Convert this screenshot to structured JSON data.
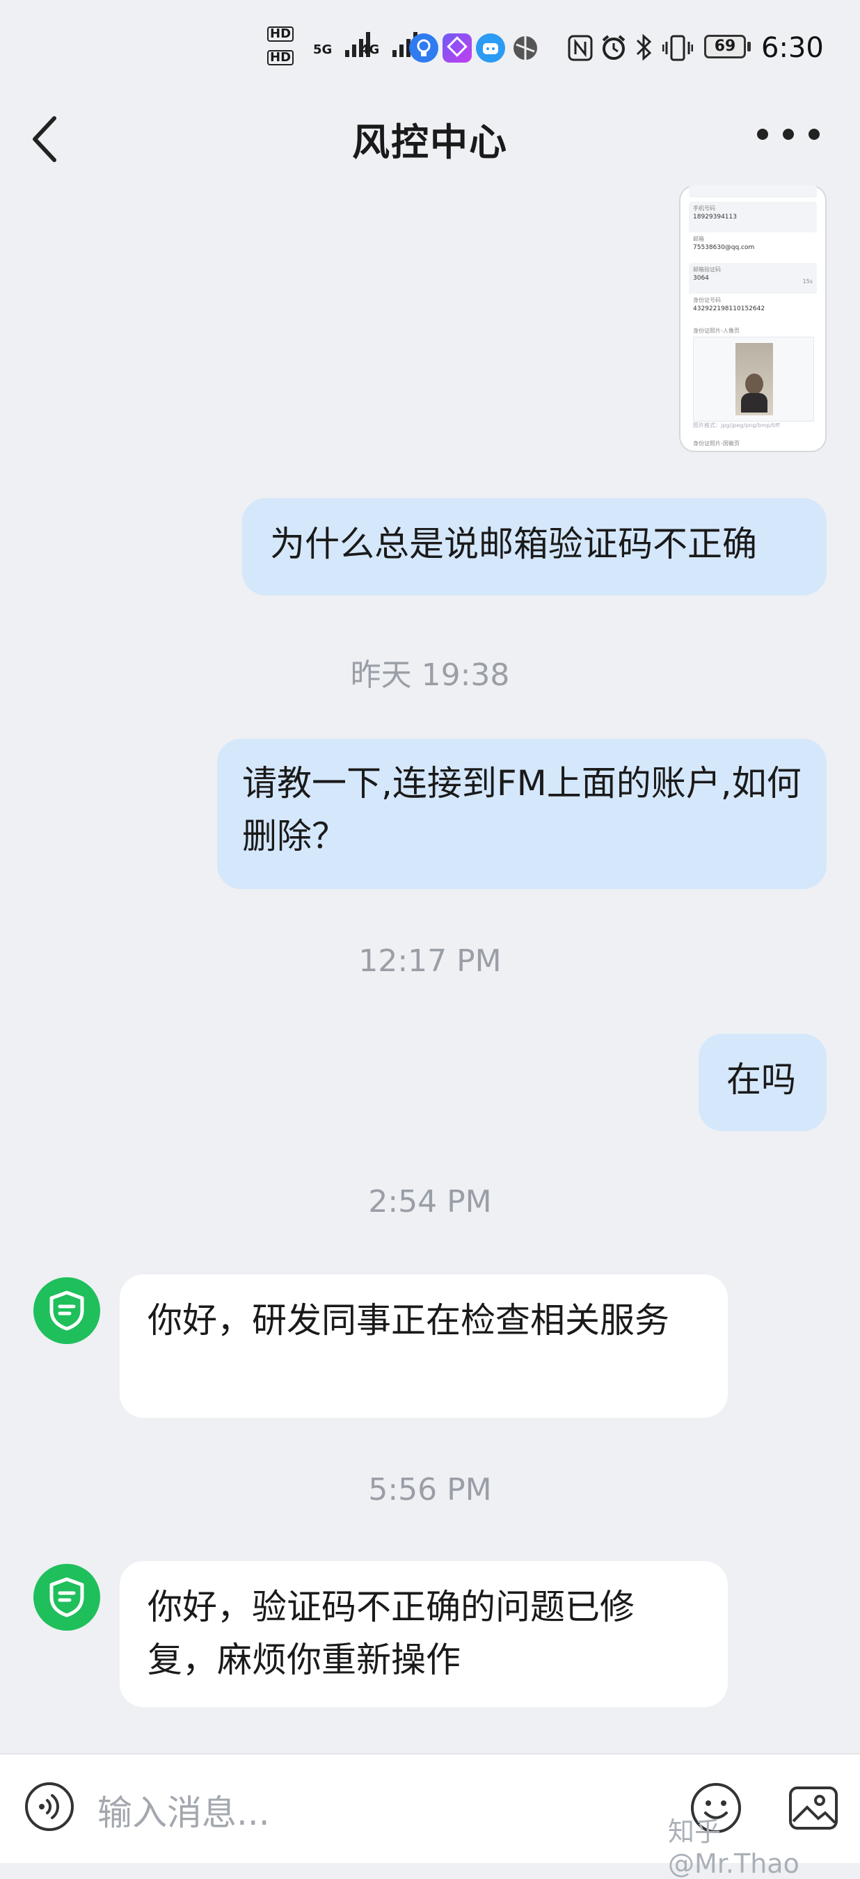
{
  "status_bar": {
    "time": "6:30",
    "battery": "69",
    "hd1": "HD",
    "hd2": "HD",
    "net1": "5G",
    "net2": "4G",
    "icons": [
      "hd-icon",
      "signal-5g-icon",
      "signal-4g-icon",
      "lightbulb-app-icon",
      "app-icon",
      "robot-app-icon",
      "browser-icon",
      "nfc-icon",
      "alarm-icon",
      "bluetooth-icon",
      "vibrate-icon",
      "battery-icon"
    ]
  },
  "header": {
    "title": "风控中心",
    "back_icon": "chevron-left-icon",
    "more_icon": "more-icon"
  },
  "thumbnail": {
    "fields": [
      {
        "label": "手机号码",
        "value": "18929394113"
      },
      {
        "label": "邮箱",
        "value": "75538630@qq.com"
      },
      {
        "label": "邮箱验证码",
        "value": "3064"
      },
      {
        "label": "身份证号码",
        "value": "432922198110152642"
      },
      {
        "label": "身份证照片-人像页",
        "value": ""
      }
    ],
    "hint": "照片格式：jpg/jpeg/png/bmp/tiff",
    "footer": "身份证照片-国徽页",
    "resend": "15s"
  },
  "messages": [
    {
      "type": "mine",
      "text": "为什么总是说邮箱验证码不正确"
    },
    {
      "type": "time",
      "text": "昨天 19:38"
    },
    {
      "type": "mine",
      "text": "请教一下,连接到FM上面的账户,如何删除？"
    },
    {
      "type": "time",
      "text": "12:17 PM"
    },
    {
      "type": "mine",
      "text": "在吗"
    },
    {
      "type": "time",
      "text": "2:54 PM"
    },
    {
      "type": "theirs",
      "text": "你好，研发同事正在检查相关服务"
    },
    {
      "type": "time",
      "text": "5:56 PM"
    },
    {
      "type": "theirs",
      "text": "你好，验证码不正确的问题已修复，麻烦你重新操作"
    }
  ],
  "bottom_bar": {
    "placeholder": "输入消息...",
    "voice_icon": "voice-icon",
    "emoji_icon": "emoji-icon",
    "image_icon": "image-icon",
    "watermark": "知乎 @Mr.Thao"
  },
  "colors": {
    "background": "#eef0f3",
    "mine_bubble": "#d5e7fb",
    "theirs_bubble": "#ffffff",
    "avatar": "#1fbf5c"
  }
}
